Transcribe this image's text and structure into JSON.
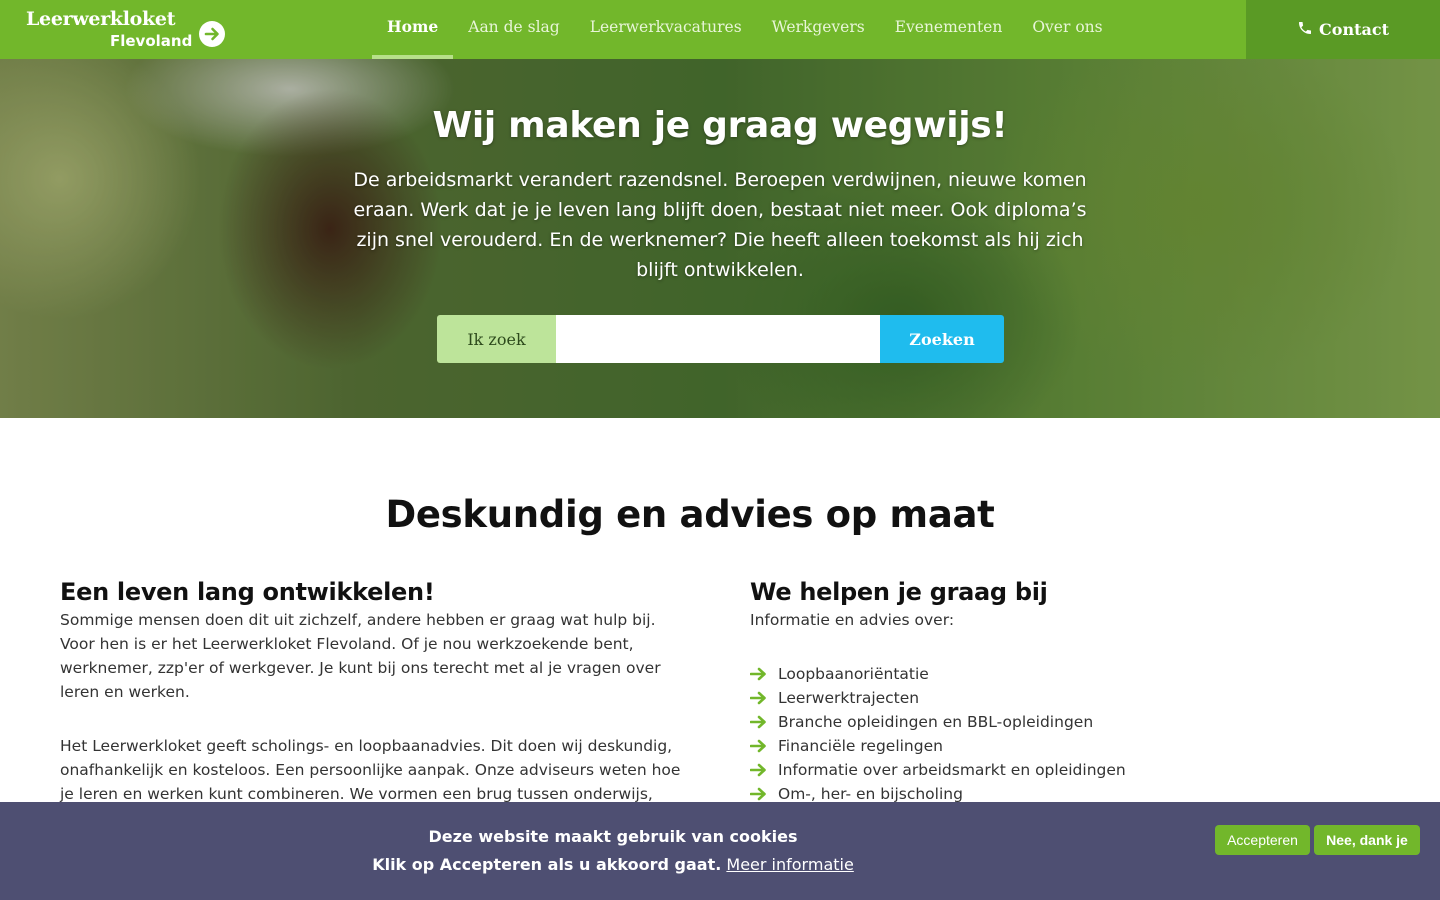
{
  "header": {
    "logo": {
      "line1": "Leerwerkloket",
      "line2": "Flevoland"
    },
    "nav": [
      {
        "label": "Home",
        "active": true
      },
      {
        "label": "Aan de slag"
      },
      {
        "label": "Leerwerkvacatures"
      },
      {
        "label": "Werkgevers"
      },
      {
        "label": "Evenementen"
      },
      {
        "label": "Over ons"
      }
    ],
    "contact_label": "Contact",
    "colors": {
      "bar": "#72b72b",
      "contact_bg": "#5a9a25",
      "active_underline": "#b7e08a"
    }
  },
  "hero": {
    "title": "Wij maken je graag wegwijs!",
    "text": "De arbeidsmarkt verandert razendsnel. Beroepen verdwijnen, nieuwe komen eraan. Werk dat je je leven lang blijft doen, bestaat niet meer. Ook diploma’s zijn snel verouderd. En de werknemer? Die heeft alleen toekomst als hij zich blijft ontwikkelen.",
    "search": {
      "label": "Ik zoek",
      "value": "",
      "button": "Zoeken"
    }
  },
  "main": {
    "title": "Deskundig en advies op maat",
    "left": {
      "heading": "Een leven lang ontwikkelen!",
      "p1": "Sommige mensen doen dit uit zichzelf, andere hebben er graag wat hulp bij. Voor hen is er het Leerwerkloket Flevoland. Of je nou werkzoekende bent, werknemer, zzp'er of werkgever. Je kunt bij ons terecht met al je vragen over leren en werken.",
      "p2": "Het Leerwerkloket geeft scholings- en loopbaanadvies. Dit doen wij deskundig, onafhankelijk en kosteloos. Een persoonlijke aanpak. Onze adviseurs weten hoe je leren en werken kunt combineren. We vormen een brug tussen onderwijs, overheid, werkgever en werknemer. Wie je ook bent en wat je vraag ook is: wij zijn"
    },
    "right": {
      "heading": "We helpen je graag bij",
      "intro": "Informatie en advies over:",
      "items": [
        "Loopbaanoriëntatie",
        "Leerwerktrajecten",
        "Branche opleidingen en BBL-opleidingen",
        "Financiële regelingen",
        "Informatie over arbeidsmarkt en opleidingen",
        "Om-, her- en bijscholing"
      ]
    }
  },
  "cookie": {
    "line1": "Deze website maakt gebruik van cookies",
    "line2": "Klik op Accepteren als u akkoord gaat.",
    "link": "Meer informatie",
    "accept": "Accepteren",
    "decline": "Nee, dank je",
    "colors": {
      "bar": "#4e4f72",
      "button": "#72b72b"
    }
  }
}
